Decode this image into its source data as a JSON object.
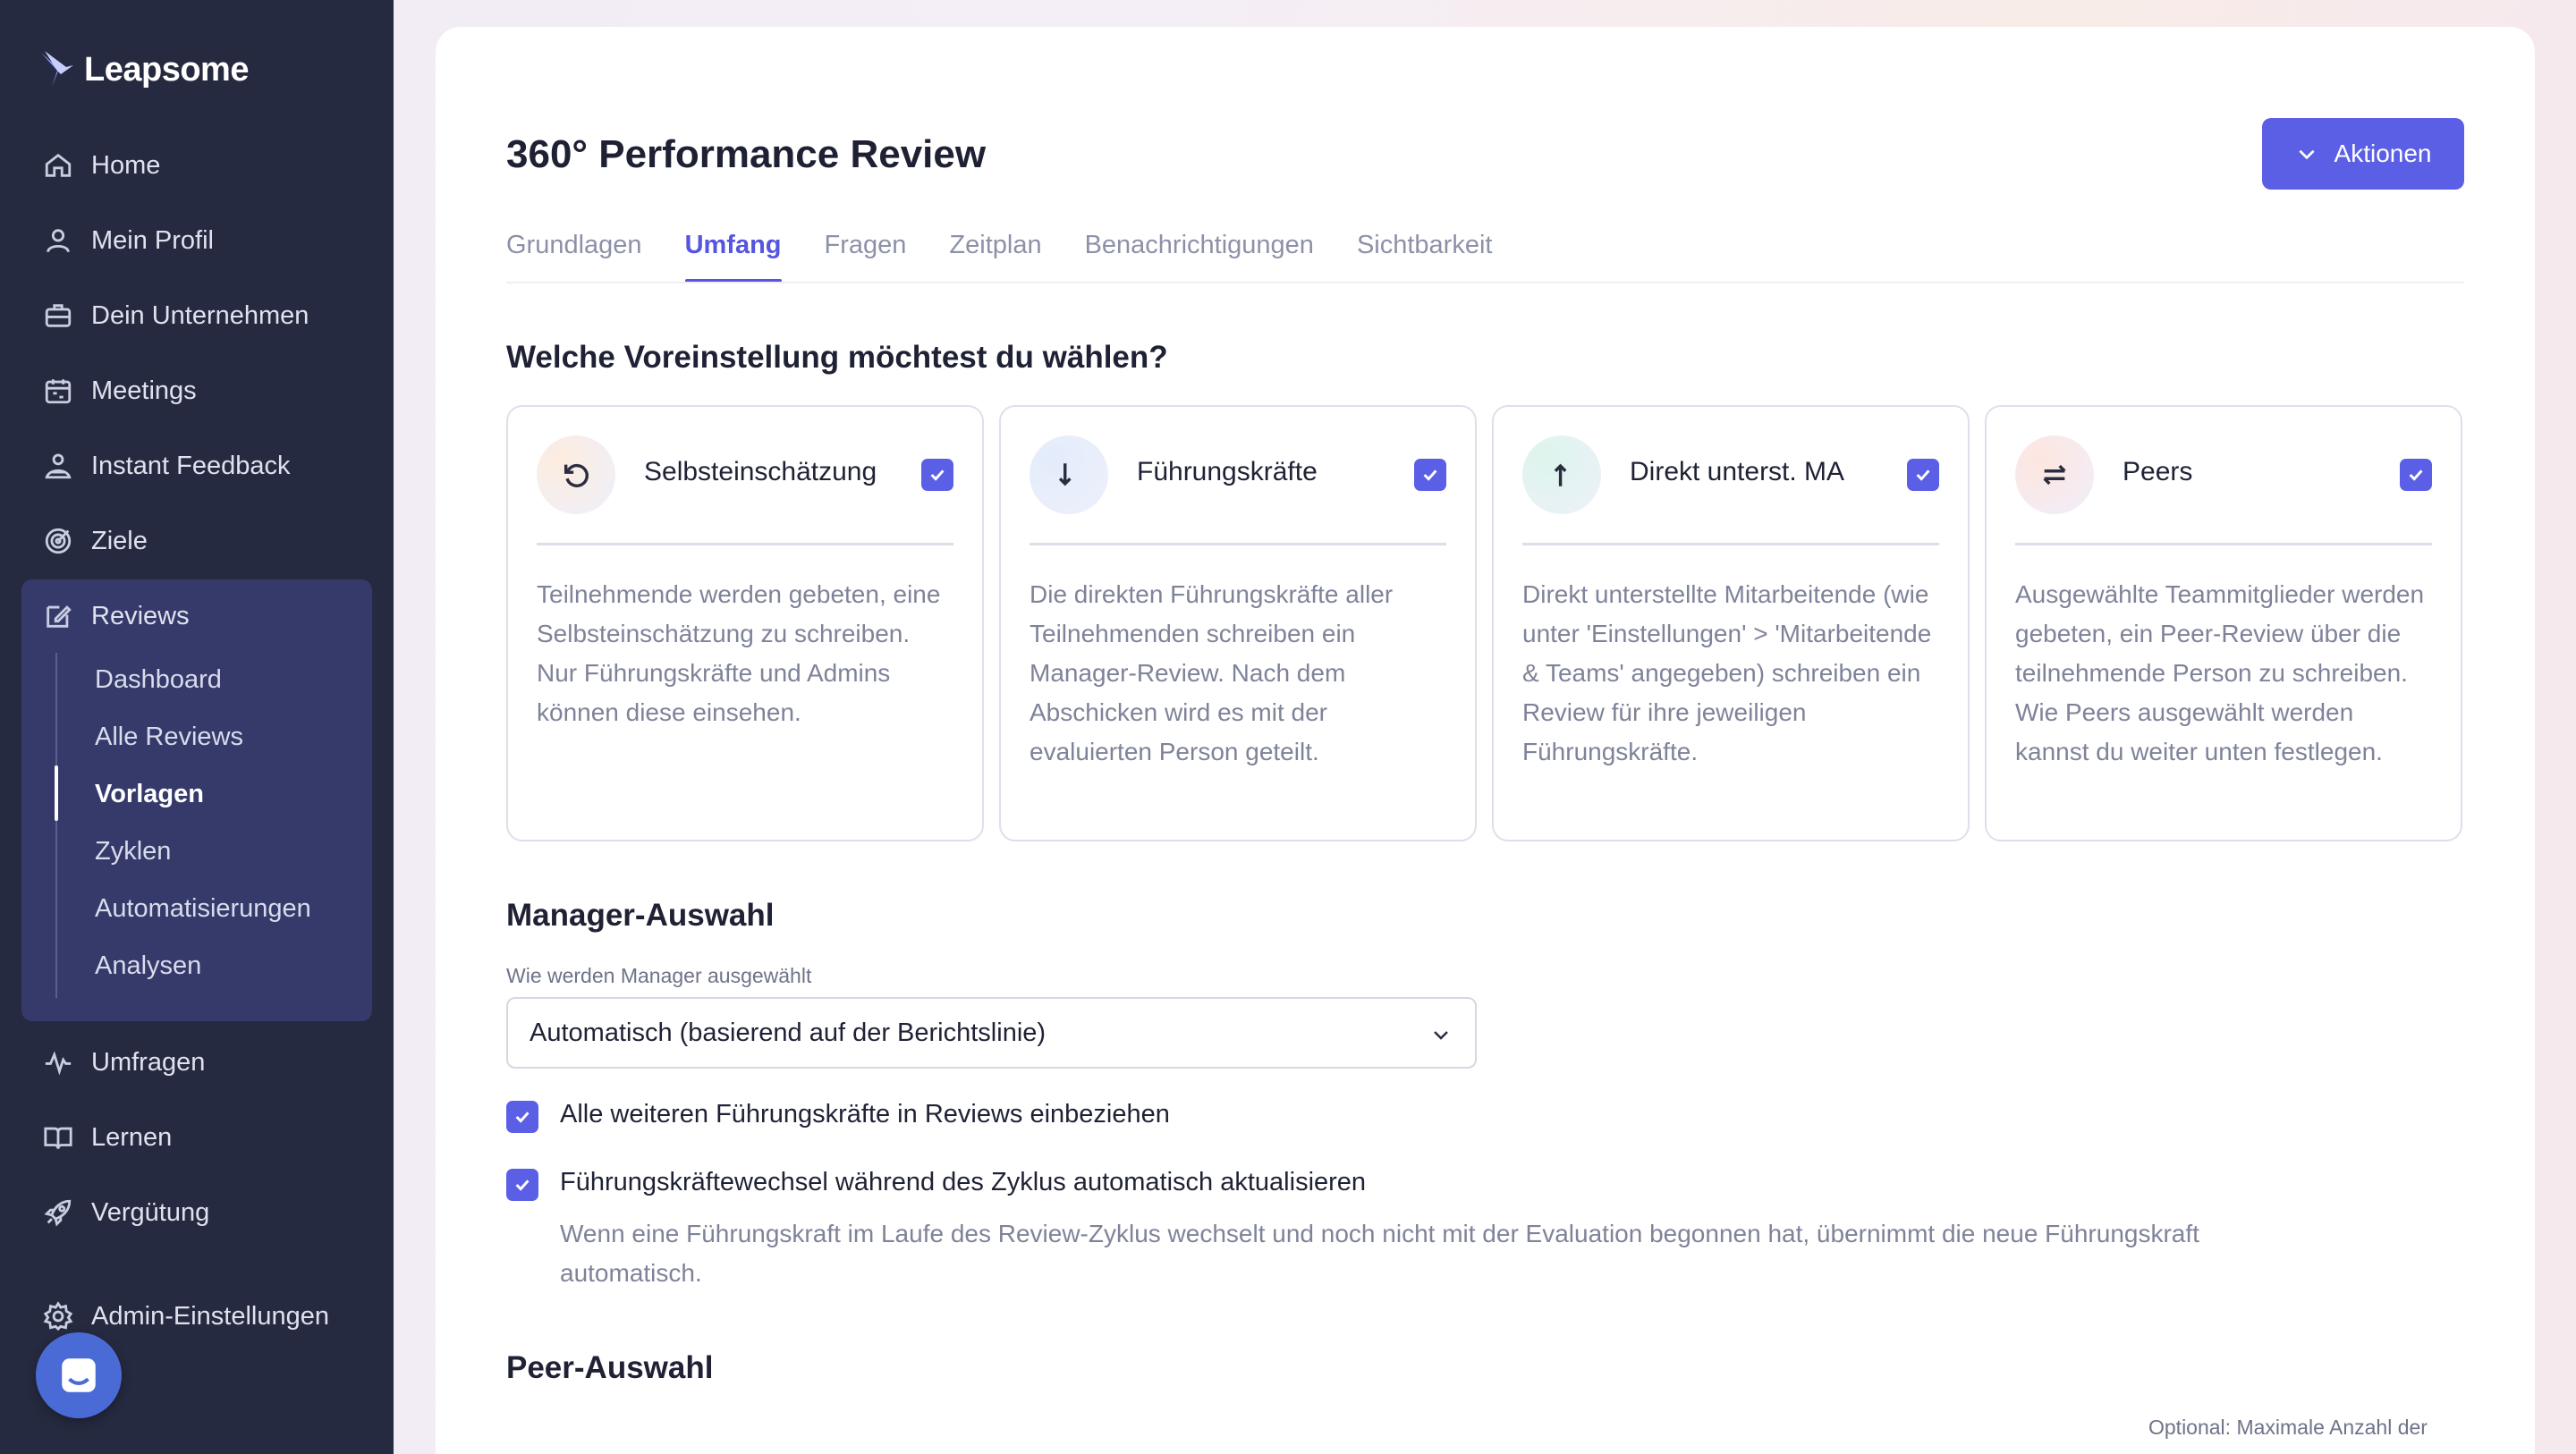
{
  "app": {
    "name": "Leapsome"
  },
  "sidebar": {
    "items": [
      {
        "label": "Home",
        "icon": "home-icon"
      },
      {
        "label": "Mein Profil",
        "icon": "user-icon"
      },
      {
        "label": "Dein Unternehmen",
        "icon": "briefcase-icon"
      },
      {
        "label": "Meetings",
        "icon": "calendar-icon"
      },
      {
        "label": "Instant Feedback",
        "icon": "feedback-icon"
      },
      {
        "label": "Ziele",
        "icon": "target-icon"
      },
      {
        "label": "Reviews",
        "icon": "edit-icon"
      },
      {
        "label": "Umfragen",
        "icon": "pulse-icon"
      },
      {
        "label": "Lernen",
        "icon": "book-icon"
      },
      {
        "label": "Vergütung",
        "icon": "rocket-icon"
      },
      {
        "label": "Admin-Einstellungen",
        "icon": "gear-icon"
      }
    ],
    "reviews_sub": [
      "Dashboard",
      "Alle Reviews",
      "Vorlagen",
      "Zyklen",
      "Automatisierungen",
      "Analysen"
    ]
  },
  "header": {
    "title": "360° Performance Review",
    "actions_label": "Aktionen"
  },
  "tabs": [
    "Grundlagen",
    "Umfang",
    "Fragen",
    "Zeitplan",
    "Benachrichtigungen",
    "Sichtbarkeit"
  ],
  "presets": {
    "title": "Welche Voreinstellung möchtest du wählen?",
    "cards": [
      {
        "title": "Selbsteinschätzung",
        "icon": "rotate-ccw-icon",
        "checked": true,
        "desc": "Teilnehmende werden gebeten, eine Selbsteinschätzung zu schreiben. Nur Führungskräfte und Admins können diese einsehen."
      },
      {
        "title": "Führungskräfte",
        "icon": "arrow-down-icon",
        "checked": true,
        "desc": "Die direkten Führungskräfte aller Teilnehmenden schreiben ein Manager-Review. Nach dem Abschicken wird es mit der evaluierten Person geteilt."
      },
      {
        "title": "Direkt unterst. MA",
        "icon": "arrow-up-icon",
        "checked": true,
        "desc": "Direkt unterstellte Mitarbeitende (wie unter 'Einstellungen' > 'Mitarbeitende & Teams' angegeben) schreiben ein Review für ihre jeweiligen Führungskräfte."
      },
      {
        "title": "Peers",
        "icon": "swap-icon",
        "checked": true,
        "desc": "Ausgewählte Teammitglieder werden gebeten, ein Peer-Review über die teilnehmende Person zu schreiben. Wie Peers ausgewählt werden kannst du weiter unten festlegen."
      }
    ]
  },
  "manager": {
    "title": "Manager-Auswahl",
    "field_label": "Wie werden Manager ausgewählt",
    "selected": "Automatisch (basierend auf der Berichtslinie)",
    "checkbox1": "Alle weiteren Führungskräfte in Reviews einbeziehen",
    "checkbox2": "Führungskräftewechsel während des Zyklus automatisch aktualisieren",
    "checkbox2_help": "Wenn eine Führungskraft im Laufe des Review-Zyklus wechselt und noch nicht mit der Evaluation begonnen hat, übernimmt die neue Führungskraft automatisch."
  },
  "peer": {
    "title": "Peer-Auswahl",
    "optional_label": "Optional: Maximale Anzahl der"
  },
  "colors": {
    "accent": "#5b5fe6",
    "sidebar_bg": "#262a40",
    "sidebar_active_bg": "#353a6a"
  }
}
